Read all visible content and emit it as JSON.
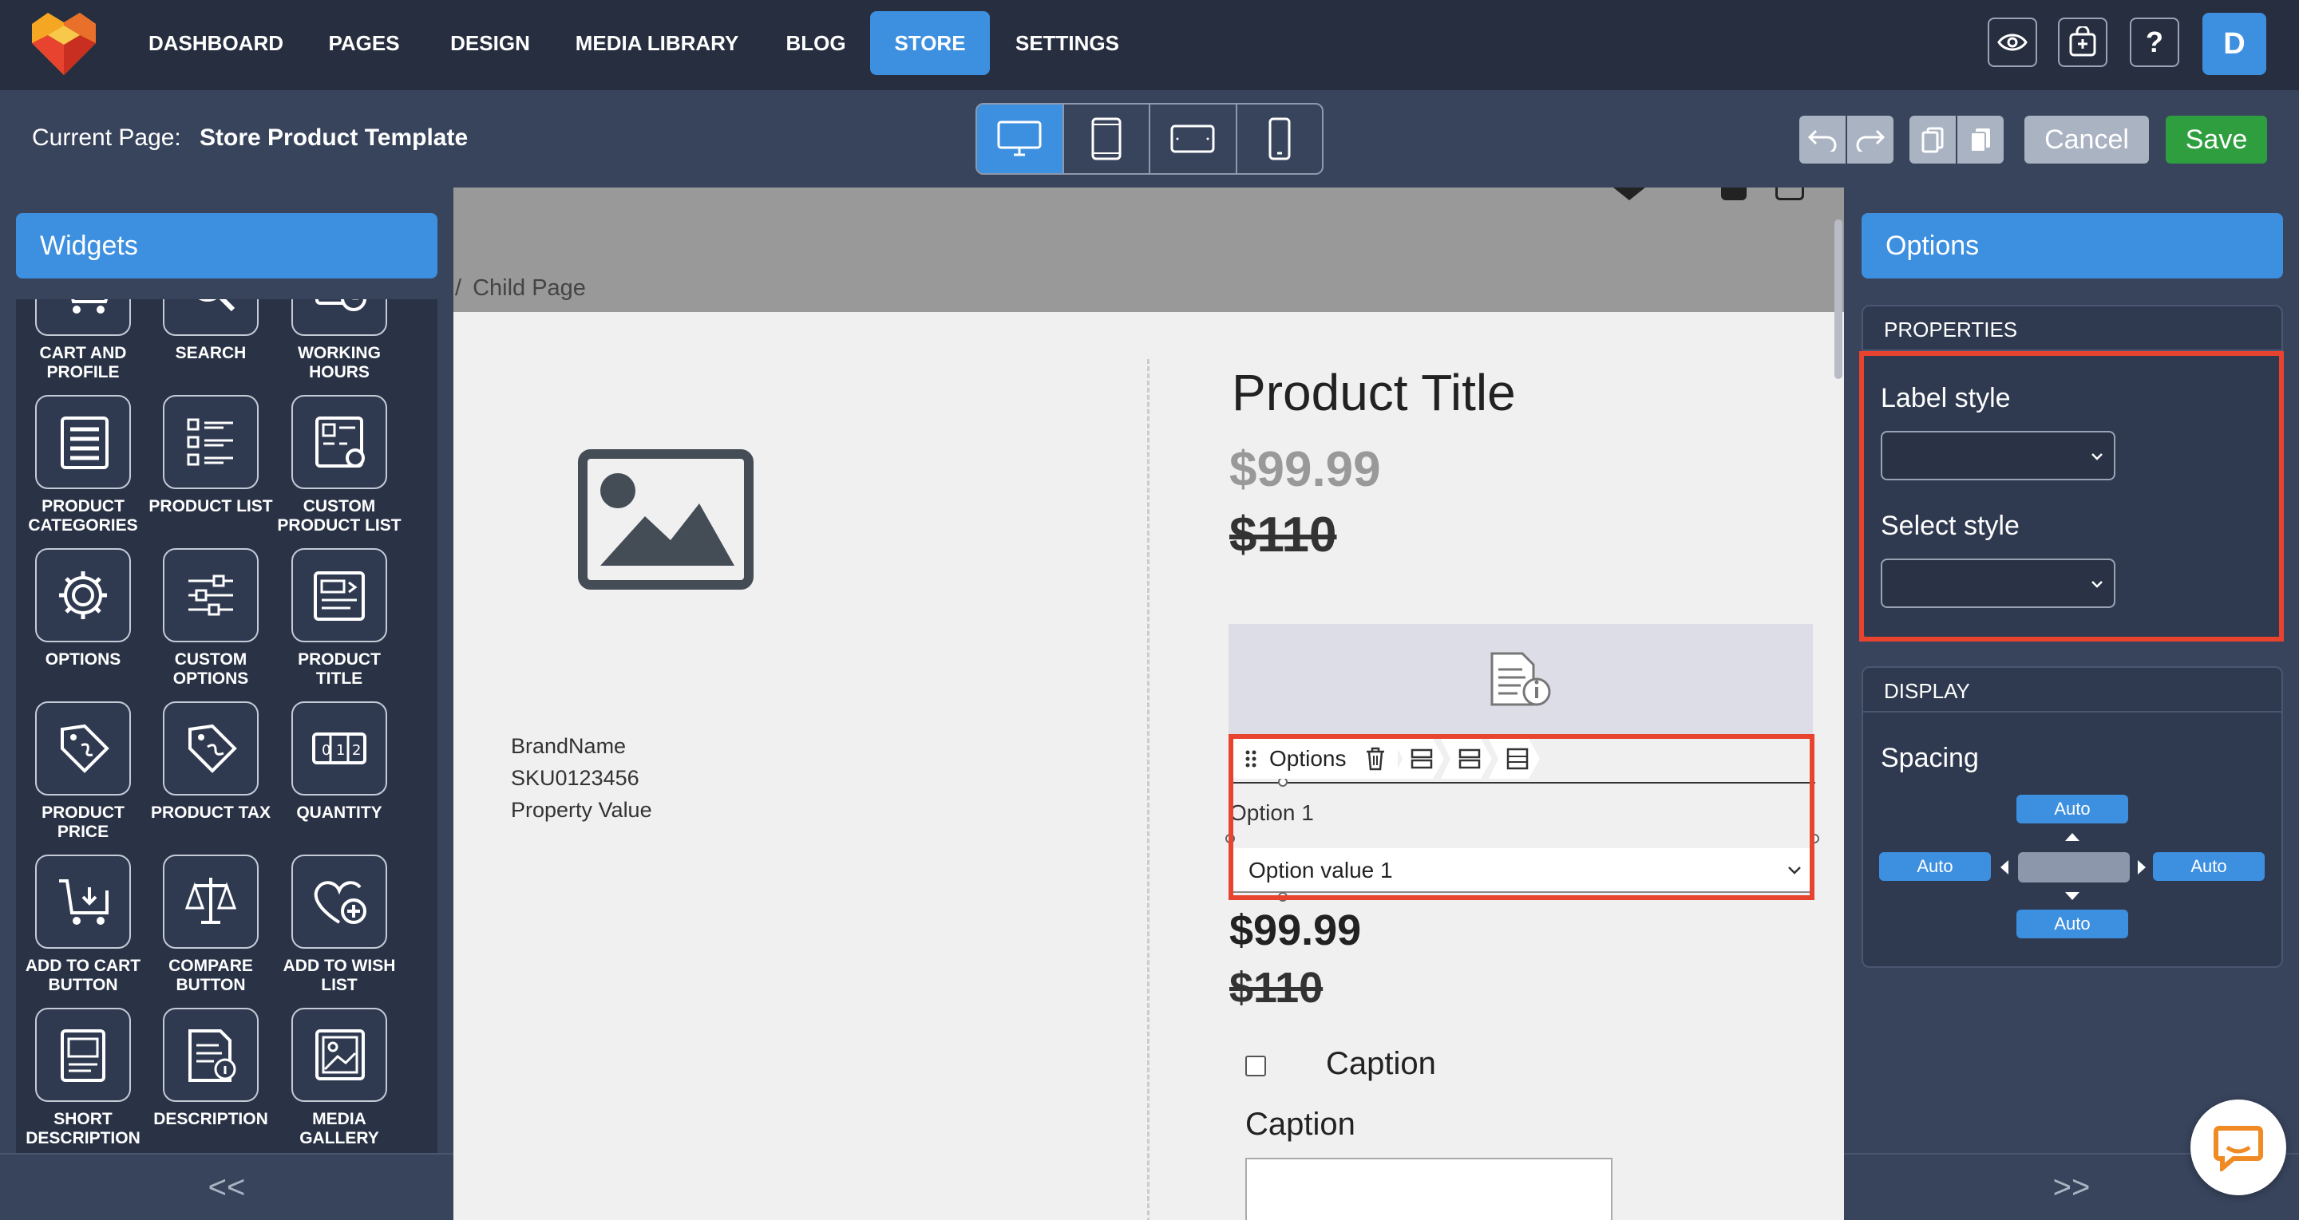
{
  "nav": {
    "items": [
      "DASHBOARD",
      "PAGES",
      "DESIGN",
      "MEDIA LIBRARY",
      "BLOG",
      "STORE",
      "SETTINGS"
    ],
    "active": "STORE",
    "avatar_initial": "D",
    "help_label": "?"
  },
  "subbar": {
    "current_page_label": "Current Page:",
    "current_page_value": "Store Product Template",
    "cancel_label": "Cancel",
    "save_label": "Save"
  },
  "widgets_panel": {
    "title": "Widgets",
    "collapse_label": "<<",
    "items": [
      {
        "label": "CART AND PROFILE",
        "icon": "cart-icon"
      },
      {
        "label": "SEARCH",
        "icon": "search-icon"
      },
      {
        "label": "WORKING HOURS",
        "icon": "clock-icon"
      },
      {
        "label": "PRODUCT CATEGORIES",
        "icon": "list-icon"
      },
      {
        "label": "PRODUCT LIST",
        "icon": "product-list-icon"
      },
      {
        "label": "CUSTOM PRODUCT LIST",
        "icon": "custom-list-icon"
      },
      {
        "label": "OPTIONS",
        "icon": "gear-icon"
      },
      {
        "label": "CUSTOM OPTIONS",
        "icon": "sliders-icon"
      },
      {
        "label": "PRODUCT TITLE",
        "icon": "title-icon"
      },
      {
        "label": "PRODUCT PRICE",
        "icon": "price-tag-icon"
      },
      {
        "label": "PRODUCT TAX",
        "icon": "tax-tag-icon"
      },
      {
        "label": "QUANTITY",
        "icon": "quantity-icon"
      },
      {
        "label": "ADD TO CART BUTTON",
        "icon": "add-cart-icon"
      },
      {
        "label": "COMPARE BUTTON",
        "icon": "scales-icon"
      },
      {
        "label": "ADD TO WISH LIST",
        "icon": "heart-plus-icon"
      },
      {
        "label": "SHORT DESCRIPTION",
        "icon": "doc-icon"
      },
      {
        "label": "DESCRIPTION",
        "icon": "doc-info-icon"
      },
      {
        "label": "MEDIA GALLERY",
        "icon": "gallery-icon"
      }
    ]
  },
  "canvas": {
    "breadcrumb_sep": "/",
    "breadcrumb": "Child Page",
    "brand": "BrandName",
    "sku": "SKU0123456",
    "property": "Property Value",
    "product_title": "Product Title",
    "price": "$99.99",
    "old_price": "$110",
    "options_chip": "Options",
    "option_label": "Option 1",
    "option_value": "Option value 1",
    "price2": "$99.99",
    "old_price2": "$110",
    "caption_checkbox": "Caption",
    "caption_field": "Caption"
  },
  "options_panel": {
    "title": "Options",
    "properties_title": "PROPERTIES",
    "label_style": "Label style",
    "select_style": "Select style",
    "display_title": "DISPLAY",
    "spacing_label": "Spacing",
    "spacing": {
      "top": "Auto",
      "left": "Auto",
      "right": "Auto",
      "bottom": "Auto"
    },
    "expand_label": ">>"
  },
  "colors": {
    "accent": "#3d8fe0",
    "save": "#2e9e3f",
    "highlight": "#e8432f",
    "topbar": "#262e3f",
    "panel": "#38445c"
  }
}
